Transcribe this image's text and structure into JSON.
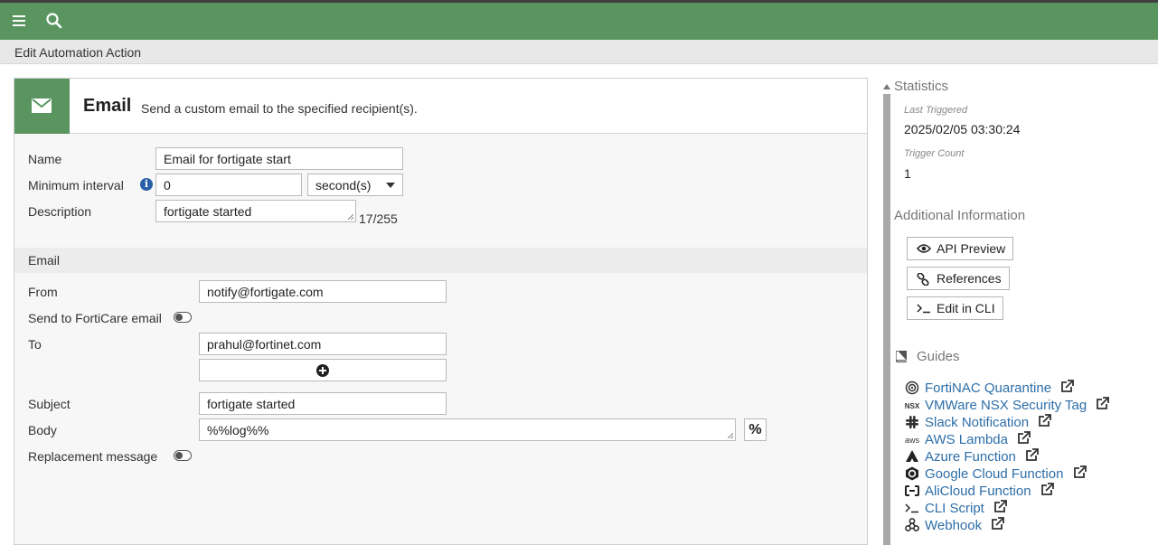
{
  "topbar": {
    "menu_icon": "hamburger-icon",
    "search_icon": "search-icon"
  },
  "page": {
    "title": "Edit Automation Action"
  },
  "action": {
    "icon": "envelope-icon",
    "title": "Email",
    "description": "Send a custom email to the specified recipient(s)."
  },
  "form": {
    "name_label": "Name",
    "name_value": "Email for fortigate start",
    "interval_label": "Minimum interval",
    "interval_value": "0",
    "interval_unit": "second(s)",
    "description_label": "Description",
    "description_value": "fortigate started",
    "description_count": "17/255"
  },
  "email": {
    "section_label": "Email",
    "from_label": "From",
    "from_value": "notify@fortigate.com",
    "forticare_label": "Send to FortiCare email",
    "to_label": "To",
    "to_value": "prahul@fortinet.com",
    "subject_label": "Subject",
    "subject_value": "fortigate started",
    "body_label": "Body",
    "body_value": "%%log%%",
    "body_button": "%",
    "replacement_label": "Replacement message"
  },
  "sidebar": {
    "statistics_label": "Statistics",
    "last_triggered_label": "Last Triggered",
    "last_triggered_value": "2025/02/05 03:30:24",
    "trigger_count_label": "Trigger Count",
    "trigger_count_value": "1",
    "additional_label": "Additional Information",
    "buttons": [
      {
        "label": "API Preview",
        "icon": "eye-icon"
      },
      {
        "label": "References",
        "icon": "link-icon"
      },
      {
        "label": "Edit in CLI",
        "icon": "terminal-icon"
      }
    ],
    "guides_label": "Guides",
    "guides": [
      {
        "label": "FortiNAC Quarantine",
        "icon": "fortinac-icon"
      },
      {
        "label": "VMWare NSX Security Tag",
        "icon": "nsx-icon",
        "icon_text": "NSX"
      },
      {
        "label": "Slack Notification",
        "icon": "slack-icon"
      },
      {
        "label": "AWS Lambda",
        "icon": "aws-icon",
        "icon_text": "aws"
      },
      {
        "label": "Azure Function",
        "icon": "azure-icon"
      },
      {
        "label": "Google Cloud Function",
        "icon": "google-cloud-icon"
      },
      {
        "label": "AliCloud Function",
        "icon": "alicloud-icon"
      },
      {
        "label": "CLI Script",
        "icon": "terminal-icon"
      },
      {
        "label": "Webhook",
        "icon": "webhook-icon"
      }
    ]
  }
}
